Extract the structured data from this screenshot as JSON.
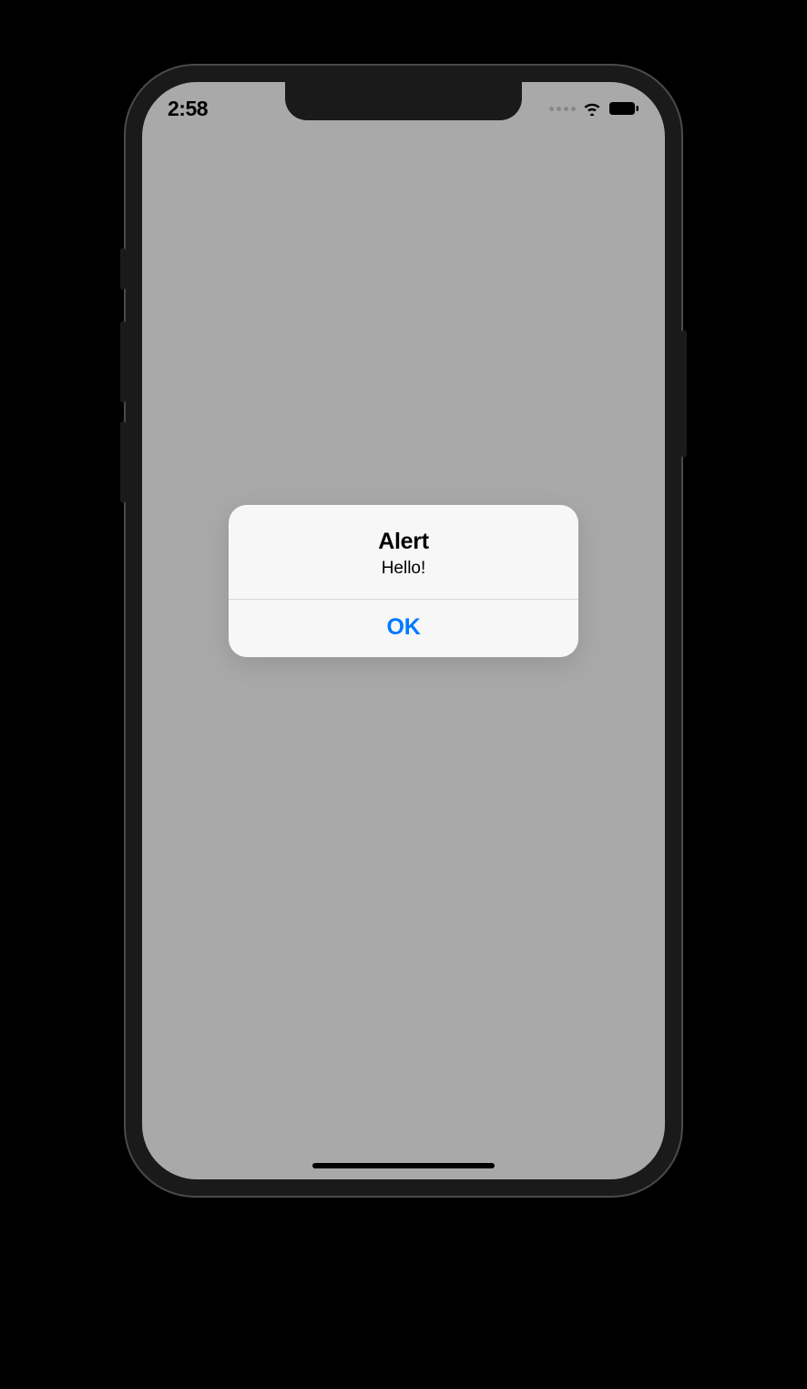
{
  "status_bar": {
    "time": "2:58"
  },
  "alert": {
    "title": "Alert",
    "message": "Hello!",
    "ok_label": "OK"
  }
}
